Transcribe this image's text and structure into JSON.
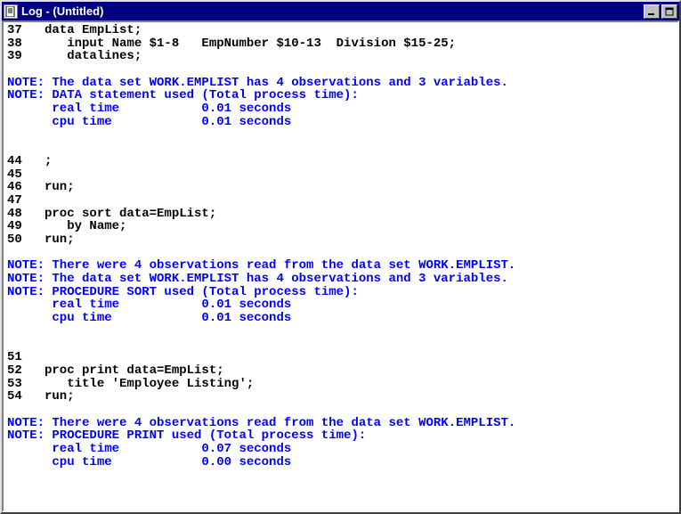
{
  "window": {
    "title": "Log - (Untitled)",
    "icon_name": "notepad-icon"
  },
  "buttons": {
    "minimize": "_",
    "maximize": "□",
    "close": "×"
  },
  "log_lines": [
    {
      "cls": "src",
      "text": "37   data EmpList;"
    },
    {
      "cls": "src",
      "text": "38      input Name $1-8   EmpNumber $10-13  Division $15-25;"
    },
    {
      "cls": "src",
      "text": "39      datalines;"
    },
    {
      "cls": "blank",
      "text": ""
    },
    {
      "cls": "note",
      "text": "NOTE: The data set WORK.EMPLIST has 4 observations and 3 variables."
    },
    {
      "cls": "note",
      "text": "NOTE: DATA statement used (Total process time):"
    },
    {
      "cls": "notedetail",
      "text": "      real time           0.01 seconds"
    },
    {
      "cls": "notedetail",
      "text": "      cpu time            0.01 seconds"
    },
    {
      "cls": "blank",
      "text": ""
    },
    {
      "cls": "blank",
      "text": ""
    },
    {
      "cls": "src",
      "text": "44   ;"
    },
    {
      "cls": "src",
      "text": "45"
    },
    {
      "cls": "src",
      "text": "46   run;"
    },
    {
      "cls": "src",
      "text": "47"
    },
    {
      "cls": "src",
      "text": "48   proc sort data=EmpList;"
    },
    {
      "cls": "src",
      "text": "49      by Name;"
    },
    {
      "cls": "src",
      "text": "50   run;"
    },
    {
      "cls": "blank",
      "text": ""
    },
    {
      "cls": "note",
      "text": "NOTE: There were 4 observations read from the data set WORK.EMPLIST."
    },
    {
      "cls": "note",
      "text": "NOTE: The data set WORK.EMPLIST has 4 observations and 3 variables."
    },
    {
      "cls": "note",
      "text": "NOTE: PROCEDURE SORT used (Total process time):"
    },
    {
      "cls": "notedetail",
      "text": "      real time           0.01 seconds"
    },
    {
      "cls": "notedetail",
      "text": "      cpu time            0.01 seconds"
    },
    {
      "cls": "blank",
      "text": ""
    },
    {
      "cls": "blank",
      "text": ""
    },
    {
      "cls": "src",
      "text": "51"
    },
    {
      "cls": "src",
      "text": "52   proc print data=EmpList;"
    },
    {
      "cls": "src",
      "text": "53      title 'Employee Listing';"
    },
    {
      "cls": "src",
      "text": "54   run;"
    },
    {
      "cls": "blank",
      "text": ""
    },
    {
      "cls": "note",
      "text": "NOTE: There were 4 observations read from the data set WORK.EMPLIST."
    },
    {
      "cls": "note",
      "text": "NOTE: PROCEDURE PRINT used (Total process time):"
    },
    {
      "cls": "notedetail",
      "text": "      real time           0.07 seconds"
    },
    {
      "cls": "notedetail",
      "text": "      cpu time            0.00 seconds"
    },
    {
      "cls": "blank",
      "text": ""
    }
  ]
}
